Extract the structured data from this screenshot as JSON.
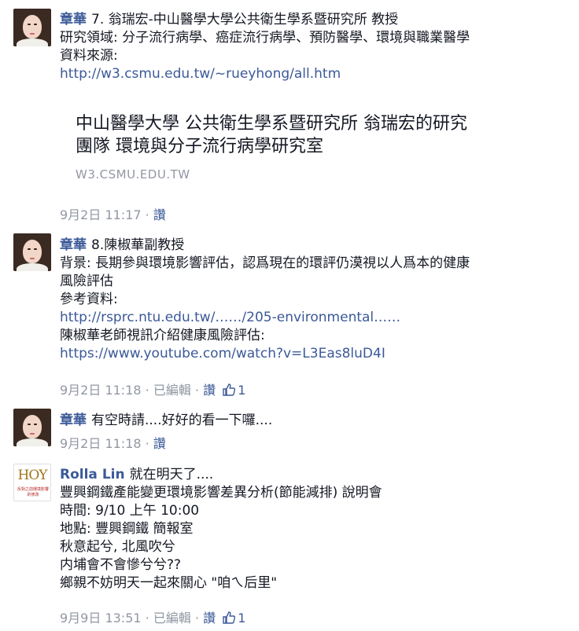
{
  "comments": [
    {
      "author": "章華",
      "lines": [
        "7. 翁瑞宏-中山醫學大學公共衛生學系暨研究所 教授",
        "研究領域: 分子流行病學、癌症流行病學、預防醫學、環境與職業醫學",
        "資料來源:"
      ],
      "link": "http://w3.csmu.edu.tw/~rueyhong/all.htm",
      "preview": {
        "title_line1": "中山醫學大學 公共衛生學系暨研究所 翁瑞宏的研究",
        "title_line2": "團隊 環境與分子流行病學研究室",
        "domain": "W3.CSMU.EDU.TW"
      },
      "meta": {
        "time": "9月2日 11:17",
        "sep": "·",
        "like": "讚"
      }
    },
    {
      "author": "章華",
      "lines": [
        "8.陳椒華副教授",
        "背景: 長期參與環境影響評估，認爲現在的環評仍漠視以人爲本的健康",
        "風險評估",
        "參考資料:"
      ],
      "link1": "http://rsprc.ntu.edu.tw/……/205-environmental……",
      "line_after": "陳椒華老師視訊介紹健康風險評估:",
      "link2": "https://www.youtube.com/watch?v=L3Eas8luD4I",
      "meta": {
        "time": "9月2日 11:18",
        "sep": "·",
        "edited": "已編輯",
        "like": "讚",
        "like_count": "1"
      }
    },
    {
      "author": "章華",
      "text": "有空時請....好好的看一下囉....",
      "meta": {
        "time": "9月2日 11:18",
        "sep": "·",
        "like": "讚"
      }
    },
    {
      "author": "Rolla Lin",
      "first_line": "就在明天了....",
      "logo_text": "HOY",
      "logo_sub": "反對之前環境影響的修改",
      "lines": [
        "豐興鋼鐵產能變更環境影響差異分析(節能減排) 說明會",
        "時間: 9/10 上午 10:00",
        "地點: 豐興鋼鐵 簡報室",
        "秋意起兮, 北風吹兮",
        "内埔會不會慘兮兮??",
        "鄉親不妨明天一起來關心 \"咱ㄟ后里\""
      ],
      "meta": {
        "time": "9月9日 13:51",
        "sep": "·",
        "edited": "已編輯",
        "like": "讚",
        "like_count": "1"
      }
    }
  ]
}
